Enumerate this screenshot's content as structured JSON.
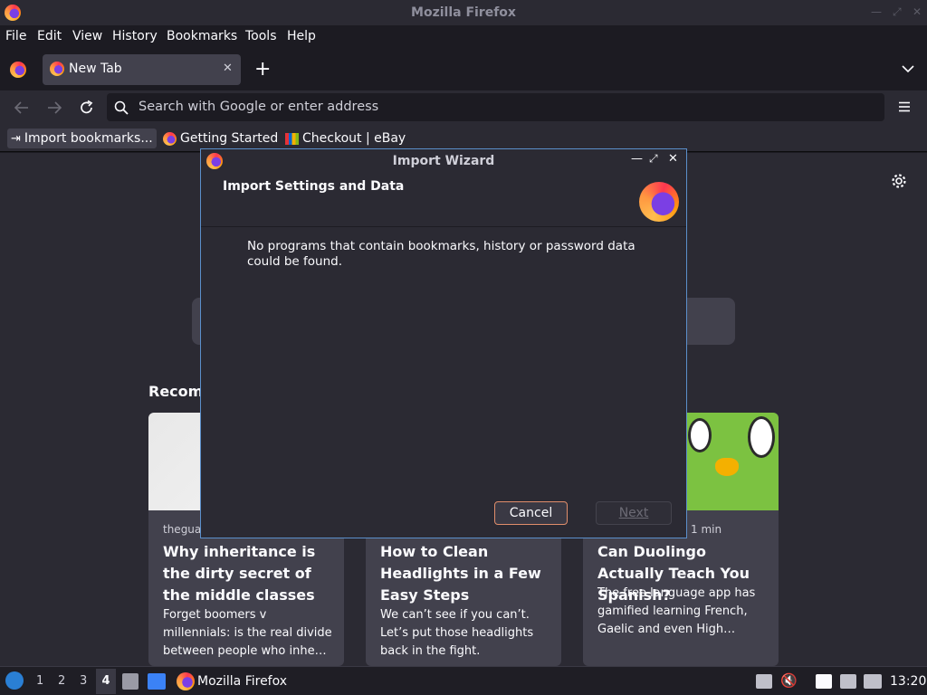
{
  "window": {
    "title": "Mozilla Firefox"
  },
  "menubar": {
    "items": [
      "File",
      "Edit",
      "View",
      "History",
      "Bookmarks",
      "Tools",
      "Help"
    ]
  },
  "tabs": [
    {
      "label": "New Tab"
    }
  ],
  "navbar": {
    "url_placeholder": "Search with Google or enter address"
  },
  "bookmarks": [
    {
      "label": "Import bookmarks..."
    },
    {
      "label": "Getting Started"
    },
    {
      "label": "Checkout | eBay"
    }
  ],
  "newtab": {
    "section_title": "Recomm",
    "cards": [
      {
        "source": "thegua",
        "headline": "Why inheritance is the dirty secret of the middle classes",
        "excerpt": "Forget boomers v millennials: is the real divide between people who inhe…"
      },
      {
        "source": "",
        "headline": "How to Clean Headlights in a Few Easy Steps",
        "excerpt": "We can’t see if you can’t. Let’s put those headlights back in the fight."
      },
      {
        "source": "1 min",
        "headline": "Can Duolingo Actually Teach You Spanish?",
        "excerpt": "The free language app has gamified learning French, Gaelic and even High…"
      }
    ]
  },
  "dialog": {
    "title": "Import Wizard",
    "header": "Import Settings and Data",
    "message": "No programs that contain bookmarks, history or password data could be found.",
    "cancel_label": "Cancel",
    "next_label": "Next"
  },
  "taskbar": {
    "workspaces": [
      "1",
      "2",
      "3",
      "4"
    ],
    "active_workspace": "4",
    "app_label": "Mozilla Firefox",
    "clock": "13:20"
  },
  "colors": {
    "accent": "#5b8fcb",
    "cancel_border": "#e08e6b",
    "dialog_bg": "#2b2a33"
  }
}
